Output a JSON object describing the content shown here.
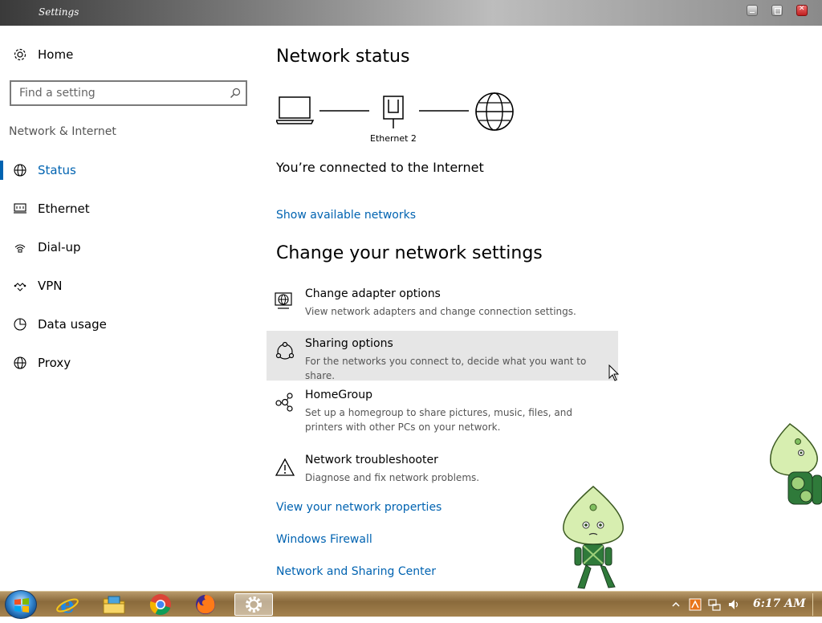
{
  "window": {
    "title": "Settings"
  },
  "sidebar": {
    "home_label": "Home",
    "search_placeholder": "Find a setting",
    "section_title": "Network & Internet",
    "items": [
      {
        "label": "Status",
        "icon": "globe-icon",
        "active": true
      },
      {
        "label": "Ethernet",
        "icon": "ethernet-icon"
      },
      {
        "label": "Dial-up",
        "icon": "dialup-icon"
      },
      {
        "label": "VPN",
        "icon": "vpn-icon"
      },
      {
        "label": "Data usage",
        "icon": "data-usage-icon"
      },
      {
        "label": "Proxy",
        "icon": "globe-icon"
      }
    ]
  },
  "main": {
    "status_heading": "Network status",
    "adapter_label": "Ethernet 2",
    "connection_text": "You’re connected to the Internet",
    "show_networks_link": "Show available networks",
    "change_heading": "Change your network settings",
    "settings": [
      {
        "title": "Change adapter options",
        "desc": "View network adapters and change connection settings.",
        "icon": "adapter-globe-icon"
      },
      {
        "title": "Sharing options",
        "desc": "For the networks you connect to, decide what you want to share.",
        "icon": "sharing-icon",
        "hover": true
      },
      {
        "title": "HomeGroup",
        "desc": "Set up a homegroup to share pictures, music, files, and printers with other PCs on your network.",
        "icon": "homegroup-icon"
      },
      {
        "title": "Network troubleshooter",
        "desc": "Diagnose and fix network problems.",
        "icon": "warning-icon"
      }
    ],
    "links": [
      "View your network properties",
      "Windows Firewall",
      "Network and Sharing Center"
    ]
  },
  "taskbar": {
    "apps": [
      "internet-explorer-icon",
      "file-explorer-icon",
      "chrome-icon",
      "firefox-icon",
      "settings-gear-icon"
    ],
    "active_app": "settings-gear-icon",
    "clock": "6:17 AM"
  },
  "colors": {
    "accent": "#0063b1",
    "hover_bg": "#e6e6e6"
  }
}
